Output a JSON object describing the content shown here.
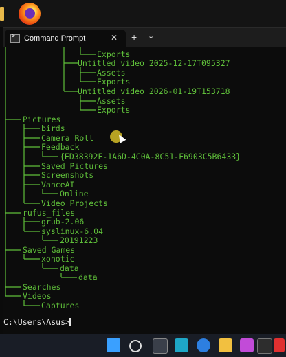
{
  "window": {
    "tab_title": "Command Prompt",
    "close_glyph": "✕",
    "new_tab_glyph": "+",
    "dropdown_glyph": "⌄"
  },
  "terminal": {
    "lines": [
      "Exports",
      "Untitled video 2025-12-17T095327",
      "Assets",
      "Exports",
      "Untitled video 2026-01-19T153718",
      "Assets",
      "Exports",
      "Pictures",
      "birds",
      "Camera Roll",
      "Feedback",
      "{ED38392F-1A6D-4C0A-8C51-F6903C5B6433}",
      "Saved Pictures",
      "Screenshots",
      "VanceAI",
      "Online",
      "Video Projects",
      "rufus_files",
      "grub-2.06",
      "syslinux-6.04",
      "20191223",
      "Saved Games",
      "xonotic",
      "data",
      "data",
      "Searches",
      "Videos",
      "Captures"
    ],
    "prompt": "C:\\Users\\Asus>"
  },
  "colors": {
    "tree_text": "#5fbf3a",
    "prompt_text": "#e6e6e6",
    "background": "#0c0c0c"
  },
  "taskbar": {
    "icons": [
      "windows-start-icon",
      "search-icon",
      "task-view-icon",
      "monitor-icon",
      "edge-icon",
      "file-explorer-icon",
      "store-icon",
      "app-icon",
      "close-app-icon"
    ]
  }
}
